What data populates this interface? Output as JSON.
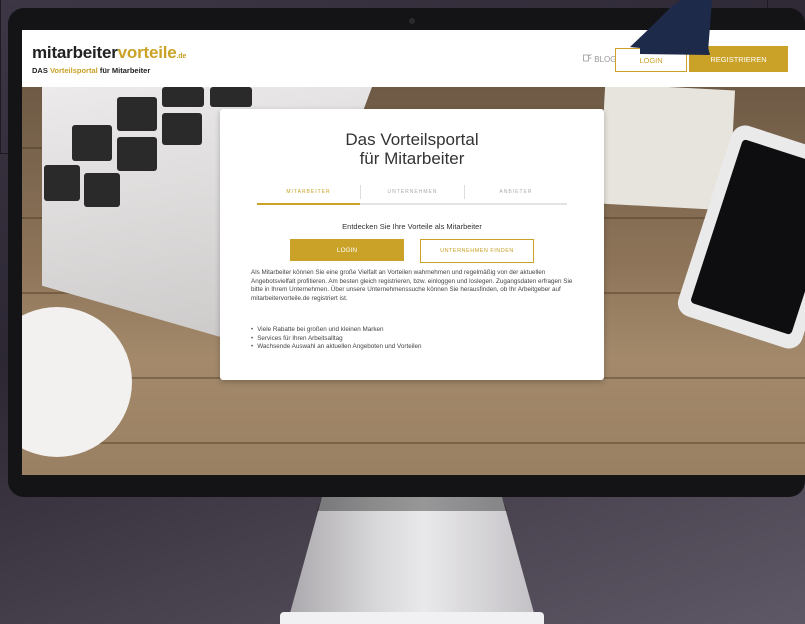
{
  "site": {
    "logo": {
      "main": "mitarbeiter",
      "accent": "vorteile",
      "tld": ".de",
      "tagline_prefix": "DAS",
      "tagline_accent": "Vorteilsportal",
      "tagline_suffix": "für Mitarbeiter"
    },
    "nav": {
      "blog_label": "BLOG",
      "login_label": "LOGIN",
      "register_label": "REGISTRIEREN"
    }
  },
  "card": {
    "title_line1": "Das Vorteilsportal",
    "title_line2": "für Mitarbeiter",
    "tabs": [
      {
        "label": "MITARBEITER"
      },
      {
        "label": "UNTERNEHMEN"
      },
      {
        "label": "ANBIETER"
      }
    ],
    "subtitle": "Entdecken Sie Ihre Vorteile als Mitarbeiter",
    "login_label": "LOGIN",
    "find_label": "UNTERNEHMEN FINDEN",
    "body": "Als Mitarbeiter können Sie eine große Vielfalt an Vorteilen wahrnehmen und regelmäßig von der aktuellen Angebotsvielfalt profitieren. Am besten gleich registrieren, bzw. einloggen und loslegen. Zugangsdaten erfragen Sie bitte in Ihrem Unternehmen. Über unsere Unternehmenssuche können Sie herausfinden, ob Ihr Arbeitgeber auf mitarbeitervorteile.de registriert ist.",
    "bullets": [
      "Viele Rabatte bei großen und kleinen Marken",
      "Services für Ihren Arbeitsalltag",
      "Wachsende Auswahl an aktuellen Angeboten und Vorteilen"
    ]
  },
  "colors": {
    "accent": "#c9a227",
    "arrow": "#1e2a4a"
  },
  "icons": {
    "blog": "blog-icon",
    "arrow": "pointer-arrow-icon"
  }
}
